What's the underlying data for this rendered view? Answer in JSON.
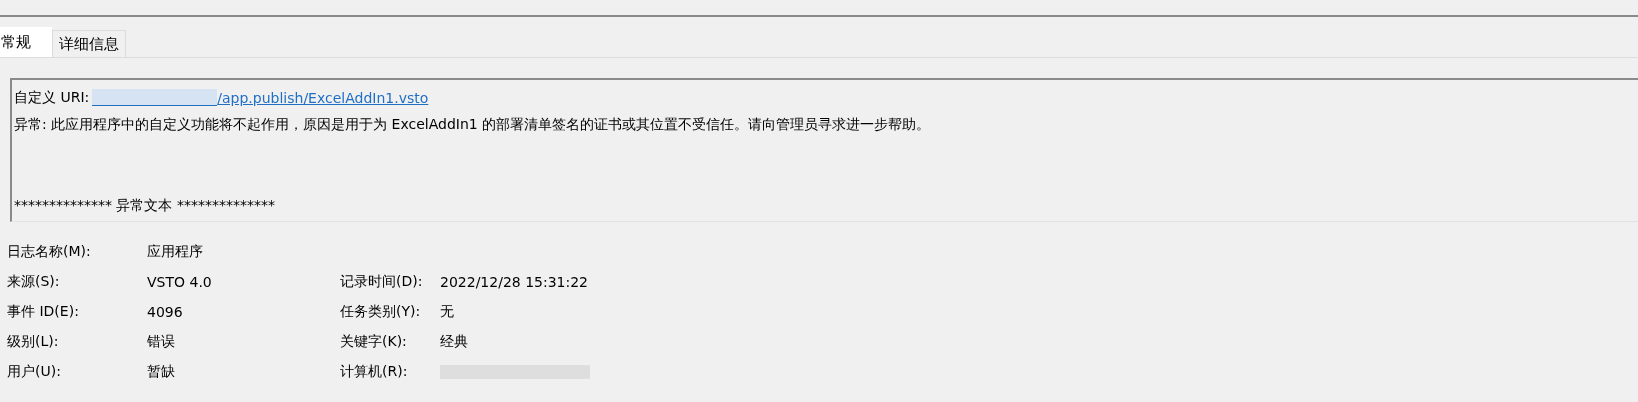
{
  "tabs": [
    {
      "label": "常规",
      "selected": true
    },
    {
      "label": "详细信息",
      "selected": false
    }
  ],
  "message_box": {
    "uri_label": "自定义 URI:",
    "uri_host_redacted": true,
    "uri_link": "/app.publish/ExcelAddIn1.vsto",
    "message": "异常: 此应用程序中的自定义功能将不起作用，原因是用于为 ExcelAddIn1 的部署清单签名的证书或其位置不受信任。请向管理员寻求进一步帮助。",
    "exception_header": "************** 异常文本 **************"
  },
  "fields": [
    {
      "left": {
        "label": "日志名称(M):",
        "value": "应用程序"
      }
    },
    {
      "left": {
        "label": "来源(S):",
        "value": "VSTO 4.0"
      },
      "right": {
        "label": "记录时间(D):",
        "value": "2022/12/28 15:31:22",
        "redacted": false
      }
    },
    {
      "left": {
        "label": "事件 ID(E):",
        "value": "4096"
      },
      "right": {
        "label": "任务类别(Y):",
        "value": "无",
        "redacted": false
      }
    },
    {
      "left": {
        "label": "级别(L):",
        "value": "错误"
      },
      "right": {
        "label": "关键字(K):",
        "value": "经典",
        "redacted": false
      }
    },
    {
      "left": {
        "label": "用户(U):",
        "value": "暂缺"
      },
      "right": {
        "label": "计算机(R):",
        "redacted": true
      }
    }
  ]
}
